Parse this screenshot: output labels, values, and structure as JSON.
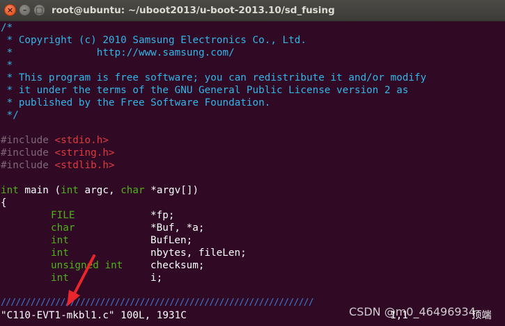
{
  "window": {
    "title": "root@ubuntu: ~/uboot2013/u-boot-2013.10/sd_fusing",
    "close_glyph": "×",
    "minimize_glyph": "–",
    "maximize_glyph": "□"
  },
  "editor": {
    "lines": {
      "l01": "/*",
      "l02": " * Copyright (c) 2010 Samsung Electronics Co., Ltd.",
      "l03": " *              http://www.samsung.com/",
      "l04": " *",
      "l05": " * This program is free software; you can redistribute it and/or modify",
      "l06": " * it under the terms of the GNU General Public License version 2 as",
      "l07": " * published by the Free Software Foundation.",
      "l08": " */",
      "inc1_kw": "#include ",
      "inc1_file": "<stdio.h>",
      "inc2_kw": "#include ",
      "inc2_file": "<string.h>",
      "inc3_kw": "#include ",
      "inc3_file": "<stdlib.h>",
      "main_int": "int",
      "main_mid": " main (",
      "main_int2": "int",
      "main_argc": " argc, ",
      "main_char": "char",
      "main_rest": " *argv[])",
      "brace": "{",
      "d1_type": "FILE",
      "d1_name": "*fp;",
      "d2_type": "char",
      "d2_name": "*Buf, *a;",
      "d3_type": "int",
      "d3_name": "BufLen;",
      "d4_type": "int",
      "d4_name": "nbytes, fileLen;",
      "d5_type": "unsigned int",
      "d5_name": "checksum;",
      "d6_type": "int",
      "d6_name": "i;",
      "partial": "///////////////////////////////////////////////////////////////"
    },
    "status": {
      "file_info": "\"C110-EVT1-mkbl1.c\" 100L, 1931C",
      "cursor_pos": "1,1",
      "scroll": "顶端"
    }
  },
  "overlay": {
    "watermark": "CSDN @m0_46496934",
    "arrow_color": "#e8262b"
  }
}
